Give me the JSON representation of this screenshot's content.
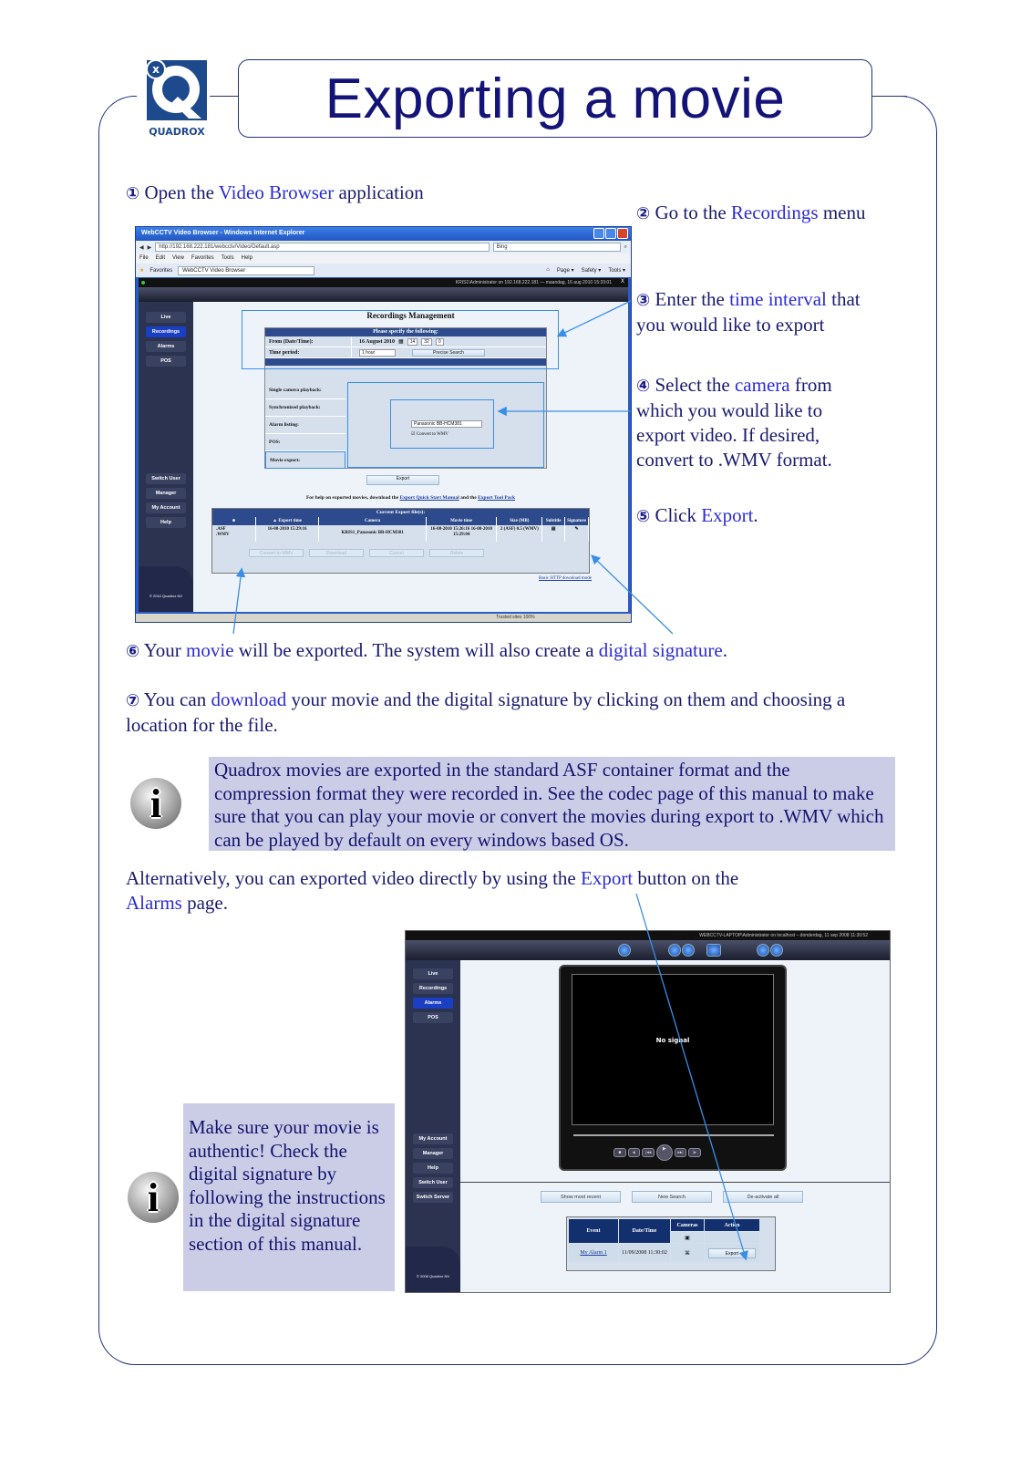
{
  "page": {
    "title": "Exporting a movie",
    "logo_text": "QUADROX"
  },
  "steps": [
    {
      "num": "①",
      "parts": [
        "Open the ",
        "Video Browser",
        " application"
      ]
    },
    {
      "num": "②",
      "parts": [
        "Go to the ",
        "Recordings",
        " menu"
      ]
    },
    {
      "num": "③",
      "parts": [
        "Enter the ",
        "time interval",
        " that you would like to export"
      ]
    },
    {
      "num": "④",
      "parts": [
        "Select the ",
        "camera",
        " from which you would like to export video. If desired, convert to .WMV format."
      ]
    },
    {
      "num": "⑤",
      "parts": [
        "Click ",
        "Export",
        "."
      ]
    },
    {
      "num": "⑥",
      "parts": [
        "Your ",
        "movie",
        " will be exported. The system will also create a ",
        "digital signature",
        "."
      ]
    },
    {
      "num": "⑦",
      "parts": [
        "You can ",
        "download",
        " your movie and the digital signature by clicking on them and choosing a location for the file."
      ]
    }
  ],
  "info1": "Quadrox movies are exported in the standard ASF container format and the compression format they were recorded in.  See the codec page of this manual to make sure that you can play your movie or convert the movies during export to .WMV which can be played by default on every windows based OS.",
  "alternative": {
    "parts": [
      "Alternatively, you can exported video directly by using the ",
      "Export",
      " button on the ",
      "Alarms",
      " page."
    ]
  },
  "info2": "Make sure your movie is authentic! Check the digital signature by following the instructions in the digital signature section of this manual.",
  "ie": {
    "window_title": "WebCCTV Video Browser - Windows Internet Explorer",
    "url": "http://192.168.222.181/webcctv/Video/Default.asp",
    "search_placeholder": "Bing",
    "menu": [
      "File",
      "Edit",
      "View",
      "Favorites",
      "Tools",
      "Help"
    ],
    "favorites_label": "Favorites",
    "tab_label": "WebCCTV Video Browser",
    "toolbar": [
      "Page ▾",
      "Safety ▾",
      "Tools ▾"
    ],
    "status": "Trusted sites    100%",
    "app_status": "KRIS1\\Administrator on 192.168.222.181 — maandag, 16 aug 2010 15:33:01",
    "sidebar_top": [
      "Live",
      "Recordings",
      "Alarms",
      "POS"
    ],
    "sidebar_bottom": [
      "Switch User",
      "Manager",
      "My Account",
      "Help"
    ],
    "copyright": "© 2010 Quadrox NV",
    "rm_title": "Recordings Management",
    "form_header": "Please specify the following:",
    "from_label": "From (Date/Time):",
    "from_date": "16 August 2010",
    "from_h": "14",
    "from_m": "32",
    "from_s": "0",
    "period_label": "Time period:",
    "period_value": "1 hour",
    "precise_search": "Precise Search",
    "options": [
      "Single camera playback:",
      "Synchronized playback:",
      "Alarm listing:",
      "POS:",
      "Movie export:"
    ],
    "camera": "Panasonic BB-HCM381",
    "convert_wmv": "Convert to WMV",
    "export_label": "Export",
    "help_prefix": "For help on exported movies, download the ",
    "help_link1": "Export Quick Start Manual",
    "help_mid": " and the ",
    "help_link2": "Export Tool Pack",
    "exports_header": "Current Export file(s):",
    "columns": [
      "■",
      "▲ Export time",
      "Camera",
      "Movie time",
      "Size (MB)",
      "Subtitle",
      "Signature"
    ],
    "row": {
      "types": ".ASF\n.WMV",
      "export_time": "16-08-2010 15:29:16",
      "camera": "KRIS1_Panasonic BB-HCM381",
      "movie_time": "16-08-2010 15:26:16 16-08-2010 15:29:04",
      "size": "2 (ASF) 0.5 (WMV)"
    },
    "buttons": [
      "Convert to WMV",
      "Download",
      "Cancel",
      "Delete"
    ],
    "basic_link": "Basic HTTP download mode"
  },
  "alarms": {
    "app_status": "WEBCCTV-LAPTOP\\Administrator on localhost – donderdag, 11 sep 2008 11:30:52",
    "sidebar_top": [
      "Live",
      "Recordings",
      "Alarms",
      "POS"
    ],
    "sidebar_bottom": [
      "My Account",
      "Manager",
      "Help",
      "Switch User",
      "Switch Server"
    ],
    "copyright": "© 2008 Quadrox NV",
    "no_signal": "No signal",
    "buttons": [
      "Show most recent",
      "New Search",
      "De-activate all"
    ],
    "columns": [
      "Event",
      "Date/Time",
      "Cameras",
      "Action"
    ],
    "row": {
      "event": "My Alarm 1",
      "datetime": "11/09/2008 11:30:02",
      "action": "Export"
    }
  },
  "colors": {
    "frame": "#22307a",
    "highlight": "#2b2bd6",
    "info_bg": "#cbcce6",
    "annotation": "#3a8ee6"
  }
}
